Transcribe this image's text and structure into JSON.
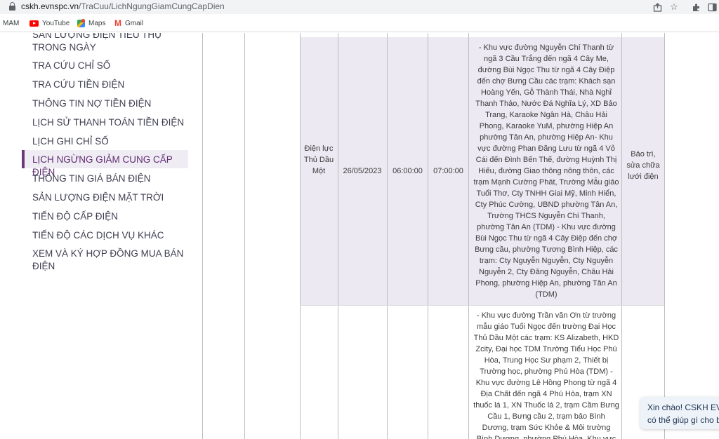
{
  "browser": {
    "url_host": "cskh.evnspc.vn",
    "url_path": "/TraCuu/LichNgungGiamCungCapDien"
  },
  "bookmarks": [
    {
      "label": "MAM"
    },
    {
      "label": "YouTube",
      "icon": "youtube-icon"
    },
    {
      "label": "Maps",
      "icon": "maps-icon"
    },
    {
      "label": "Gmail",
      "icon": "gmail-icon"
    }
  ],
  "sidebar": {
    "items": [
      {
        "label": "SẢN LƯỢNG ĐIỆN TIÊU THỤ TRONG NGÀY"
      },
      {
        "label": "TRA CỨU CHỈ SỐ"
      },
      {
        "label": "TRA CỨU TIỀN ĐIỆN"
      },
      {
        "label": "THÔNG TIN NỢ TIỀN ĐIỆN"
      },
      {
        "label": "LỊCH SỬ THANH TOÁN TIỀN ĐIỆN"
      },
      {
        "label": "LỊCH GHI CHỈ SỐ"
      },
      {
        "label": "LỊCH NGỪNG GIẢM CUNG CẤP ĐIỆN",
        "active": true
      },
      {
        "label": "THÔNG TIN GIÁ BÁN ĐIỆN"
      },
      {
        "label": "SẢN LƯỢNG ĐIỆN MẶT TRỜI"
      },
      {
        "label": "TIẾN ĐỘ CẤP ĐIỆN"
      },
      {
        "label": "TIẾN ĐỘ CÁC DỊCH VỤ KHÁC"
      },
      {
        "label": "XEM VÀ KÝ HỢP ĐỒNG MUA BÁN ĐIỆN"
      }
    ],
    "accent_color": "#6a3a78"
  },
  "table": {
    "rows": [
      {
        "unit": "Điện lực Thủ Dầu Một",
        "date": "26/05/2023",
        "start": "06:00:00",
        "end": "07:00:00",
        "area": "- Khu vực đường Nguyễn Chí Thanh từ ngã 3 Cầu Trắng đến ngã 4 Cây Me, đường Bùi Ngọc Thu từ ngã 4 Cây Điệp đến chợ Bưng Cầu các trạm: Khách sạn Hoàng Yến, Gỗ Thành Thái, Nhà Nghỉ Thanh Thảo, Nước Đá Nghĩa Lý, XD Bảo Trang, Karaoke Ngân Hà, Châu Hải Phong, Karaoke YuM, phường Hiệp An phường Tân An, phường Hiệp An- Khu vực đường Phan Đăng Lưu từ ngã 4 Vỏ Cái đến Đình Bến Thế, đường Huỳnh Thị Hiếu, đường Giao thông nông thôn, các trạm Mạnh Cường Phát, Trường Mẫu giáo Tuổi Thơ, Cty TNHH Giai Mỹ, Minh Hiển, Cty Phúc Cường, UBND phường Tân An, Trường THCS Nguyễn Chí Thanh, phường Tân An (TDM) - Khu vực đường Bùi Ngọc Thu từ ngã 4 Cây Điệp đến chợ Bưng cầu, phường Tương Bình Hiệp, các trạm: Cty Nguyễn Nguyễn, Cty Nguyễn Nguyễn 2, Cty Đăng Nguyễn, Châu Hải Phong, phường Hiệp An, phường Tân An (TDM)",
        "reason": "Bảo trì, sửa chữa lưới điện"
      },
      {
        "area": "- Khu vực đường Trần văn Ơn từ trường mẫu giáo Tuổi Ngọc đến trường Đại Học Thủ Dầu Một các trạm: KS Alizabeth, HKD Zcity, Đại học TDM Trường Tiểu Học Phú Hòa, Trung Học Sư phạm 2, Thiết bị Trường học, phường Phú Hòa (TDM) - Khu vực đường Lê Hồng Phong từ ngã 4 Địa Chất đến ngã 4 Phú Hòa, trạm XN thuốc lá 1, XN Thuốc lá 2, trạm Cầm Bưng Cầu 1, Bưng cầu 2, trạm bảo Bình Dương, trạm Sức Khỏe & Môi trường Bình Dương, phường Phú Hòa, Khu vực"
      }
    ]
  },
  "chat": {
    "line1": "Xin chào! CSKH EVN",
    "line2": "có thể giúp gì cho bạn"
  }
}
